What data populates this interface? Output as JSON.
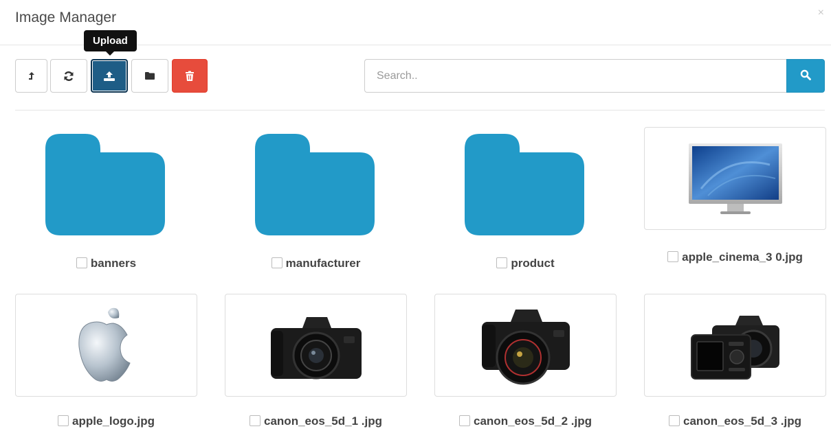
{
  "header": {
    "title": "Image Manager",
    "close_glyph": "×"
  },
  "toolbar": {
    "buttons": [
      {
        "name": "parent-directory",
        "icon": "level-up-icon"
      },
      {
        "name": "refresh",
        "icon": "refresh-icon"
      },
      {
        "name": "upload",
        "icon": "upload-icon",
        "active": true
      },
      {
        "name": "new-folder",
        "icon": "folder-icon"
      },
      {
        "name": "delete",
        "icon": "trash-icon"
      }
    ],
    "tooltip": "Upload"
  },
  "search": {
    "placeholder": "Search..",
    "value": "",
    "button_icon": "search-icon"
  },
  "folders": [
    {
      "name": "banners"
    },
    {
      "name": "manufacturer"
    },
    {
      "name": "product"
    }
  ],
  "images": [
    {
      "name": "apple_cinema_3 0.jpg",
      "thumbnail": "monitor"
    },
    {
      "name": "apple_logo.jpg",
      "thumbnail": "apple-logo"
    },
    {
      "name": "canon_eos_5d_1 .jpg",
      "thumbnail": "camera"
    },
    {
      "name": "canon_eos_5d_2 .jpg",
      "thumbnail": "camera"
    },
    {
      "name": "canon_eos_5d_3 .jpg",
      "thumbnail": "camera-back"
    }
  ],
  "colors": {
    "folder": "#229ac8",
    "primary": "#1e5d86",
    "danger": "#e74c3c",
    "search_button": "#229ac8"
  }
}
